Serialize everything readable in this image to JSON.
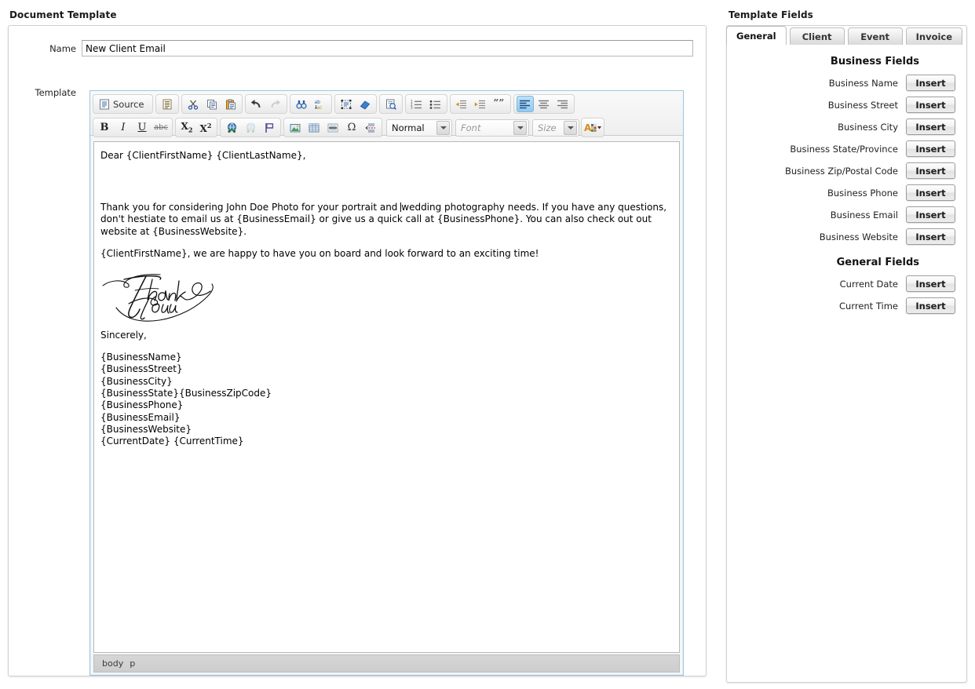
{
  "left": {
    "panel_title": "Document Template",
    "name_label": "Name",
    "name_value": "New Client Email",
    "template_label": "Template"
  },
  "editor": {
    "toolbar": {
      "source_label": "Source",
      "row1": [
        {
          "name": "source-button",
          "label": "Source",
          "icon": "source-icon"
        },
        {
          "name": "templates-button",
          "label": "",
          "icon": "templates-icon"
        },
        {
          "name": "cut-button",
          "label": "",
          "icon": "cut-icon"
        },
        {
          "name": "copy-button",
          "label": "",
          "icon": "copy-icon"
        },
        {
          "name": "paste-button",
          "label": "",
          "icon": "paste-icon"
        },
        {
          "name": "undo-button",
          "label": "",
          "icon": "undo-icon"
        },
        {
          "name": "redo-button",
          "label": "",
          "icon": "redo-icon"
        },
        {
          "name": "find-button",
          "label": "",
          "icon": "find-icon"
        },
        {
          "name": "replace-button",
          "label": "",
          "icon": "replace-icon"
        },
        {
          "name": "select-all-button",
          "label": "",
          "icon": "select-all-icon"
        },
        {
          "name": "remove-format-button",
          "label": "",
          "icon": "eraser-icon"
        },
        {
          "name": "spellcheck-button",
          "label": "",
          "icon": "spellcheck-icon"
        },
        {
          "name": "numbered-list-button",
          "label": "",
          "icon": "numbered-list-icon"
        },
        {
          "name": "bulleted-list-button",
          "label": "",
          "icon": "bulleted-list-icon"
        },
        {
          "name": "outdent-button",
          "label": "",
          "icon": "outdent-icon"
        },
        {
          "name": "indent-button",
          "label": "",
          "icon": "indent-icon"
        },
        {
          "name": "blockquote-button",
          "label": "",
          "icon": "blockquote-icon"
        },
        {
          "name": "align-left-button",
          "label": "",
          "icon": "align-left-icon"
        },
        {
          "name": "align-center-button",
          "label": "",
          "icon": "align-center-icon"
        },
        {
          "name": "align-right-button",
          "label": "",
          "icon": "align-right-icon"
        }
      ],
      "row2": [
        {
          "name": "bold-button",
          "label": "B",
          "icon": "bold-icon"
        },
        {
          "name": "italic-button",
          "label": "I",
          "icon": "italic-icon"
        },
        {
          "name": "underline-button",
          "label": "U",
          "icon": "underline-icon"
        },
        {
          "name": "strikethrough-button",
          "label": "abc",
          "icon": "strikethrough-icon"
        },
        {
          "name": "subscript-button",
          "label": "X2",
          "icon": "subscript-icon"
        },
        {
          "name": "superscript-button",
          "label": "X2",
          "icon": "superscript-icon"
        },
        {
          "name": "link-button",
          "label": "",
          "icon": "link-icon"
        },
        {
          "name": "unlink-button",
          "label": "",
          "icon": "unlink-icon"
        },
        {
          "name": "anchor-button",
          "label": "",
          "icon": "anchor-flag-icon"
        },
        {
          "name": "image-button",
          "label": "",
          "icon": "image-icon"
        },
        {
          "name": "table-button",
          "label": "",
          "icon": "table-icon"
        },
        {
          "name": "horizontal-rule-button",
          "label": "",
          "icon": "horizontal-rule-icon"
        },
        {
          "name": "special-char-button",
          "label": "",
          "icon": "omega-icon"
        },
        {
          "name": "page-break-button",
          "label": "",
          "icon": "page-break-icon"
        },
        {
          "name": "text-color-button",
          "label": "",
          "icon": "text-color-icon"
        }
      ],
      "format_combo": "Normal",
      "font_combo": "Font",
      "size_combo": "Size"
    },
    "content": {
      "greeting": "Dear {ClientFirstName} {ClientLastName},",
      "body_part1": "Thank you for considering John Doe Photo for your portrait and ",
      "body_part2": "wedding photography needs. If you have any questions, don't hestiate to email us at {BusinessEmail} or give us a quick call at {BusinessPhone}. You can also check out out website at {BusinessWebsite}.",
      "closing_line": "{ClientFirstName}, we are happy to have you on board and look forward to an exciting time!",
      "thank_you_image_alt": "Thank You",
      "sincerely": "Sincerely,",
      "signature_lines": [
        "{BusinessName}",
        "{BusinessStreet}",
        "{BusinessCity}",
        "{BusinessState}{BusinessZipCode}",
        "{BusinessPhone}",
        "{BusinessEmail}",
        "{BusinessWebsite}",
        "{CurrentDate} {CurrentTime}"
      ]
    },
    "status_path": [
      "body",
      "p"
    ]
  },
  "right": {
    "panel_title": "Template Fields",
    "tabs": [
      {
        "label": "General",
        "active": true
      },
      {
        "label": "Client",
        "active": false
      },
      {
        "label": "Event",
        "active": false
      },
      {
        "label": "Invoice",
        "active": false
      }
    ],
    "sections": [
      {
        "title": "Business Fields",
        "fields": [
          {
            "label": "Business Name",
            "button": "Insert"
          },
          {
            "label": "Business Street",
            "button": "Insert"
          },
          {
            "label": "Business City",
            "button": "Insert"
          },
          {
            "label": "Business State/Province",
            "button": "Insert"
          },
          {
            "label": "Business Zip/Postal Code",
            "button": "Insert"
          },
          {
            "label": "Business Phone",
            "button": "Insert"
          },
          {
            "label": "Business Email",
            "button": "Insert"
          },
          {
            "label": "Business Website",
            "button": "Insert"
          }
        ]
      },
      {
        "title": "General Fields",
        "fields": [
          {
            "label": "Current Date",
            "button": "Insert"
          },
          {
            "label": "Current Time",
            "button": "Insert"
          }
        ]
      }
    ]
  },
  "colors": {
    "accent": "#93c9ef",
    "editor_border": "#9fc6e0",
    "panel_border": "#cfcfcf",
    "status_bar": "#d3d3d3"
  }
}
